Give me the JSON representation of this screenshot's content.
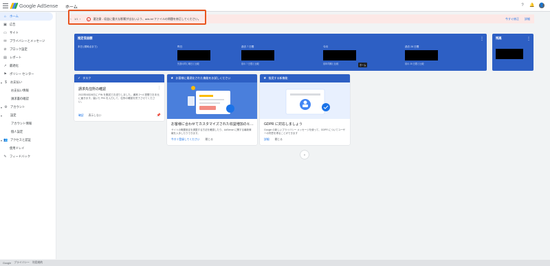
{
  "app": {
    "brand": "Google AdSense",
    "page_title": "ホーム"
  },
  "header": {
    "help_icon": "?",
    "bell_icon": "🔔",
    "avatar_icon": "👤"
  },
  "sidebar": {
    "items": [
      {
        "icon": "⌂",
        "label": "ホーム",
        "active": true,
        "kind": "top"
      },
      {
        "icon": "▣",
        "label": "広告",
        "kind": "top"
      },
      {
        "icon": "▭",
        "label": "サイト",
        "kind": "top"
      },
      {
        "icon": "✉",
        "label": "プライバシーとメッセージ",
        "kind": "top"
      },
      {
        "icon": "⊘",
        "label": "ブロック設定",
        "kind": "top"
      },
      {
        "icon": "▤",
        "label": "レポート",
        "kind": "top"
      },
      {
        "icon": "↗",
        "label": "最適化",
        "kind": "top"
      },
      {
        "icon": "⚑",
        "label": "ポリシー センター",
        "kind": "top"
      },
      {
        "icon": "$",
        "label": "お支払い",
        "kind": "exp"
      },
      {
        "icon": "",
        "label": "お支払い情報",
        "kind": "sub"
      },
      {
        "icon": "",
        "label": "請求書の確認",
        "kind": "sub"
      },
      {
        "icon": "⚙",
        "label": "アカウント",
        "kind": "exp"
      },
      {
        "icon": "",
        "label": "設定",
        "kind": "exp"
      },
      {
        "icon": "",
        "label": "アカウント情報",
        "kind": "sub"
      },
      {
        "icon": "",
        "label": "個人設定",
        "kind": "sub"
      },
      {
        "icon": "👥",
        "label": "アクセスと認証",
        "kind": "exp"
      },
      {
        "icon": "",
        "label": "使用ドレイ",
        "kind": "top"
      },
      {
        "icon": "✎",
        "label": "フィードバック",
        "kind": "top"
      }
    ]
  },
  "alert": {
    "prev": "‹",
    "counter": "1/1",
    "next": "›",
    "warn_icon": "!",
    "message": "要注意 - 収益に重大な影響が出ないよう、ads.txt ファイルの問題を修正してください。",
    "action_fix": "今すぐ修正",
    "action_details": "詳細"
  },
  "earnings": {
    "title": "推定収益額",
    "menu": "⋮",
    "columns": [
      {
        "label": "本日 (現時点まで)",
        "sub": ""
      },
      {
        "label": "昨日",
        "sub": "先週の同じ曜日と比較"
      },
      {
        "label": "過去 7 日間",
        "sub": "前の 7 日間と比較"
      },
      {
        "label": "今月",
        "sub": "前年同期と比較"
      },
      {
        "label": "過去 28 日間",
        "sub": "前の 28 日間と比較"
      }
    ],
    "tooltip": "ホーム"
  },
  "balance": {
    "title": "残高",
    "menu": "⋮"
  },
  "task_card": {
    "header": "タスク",
    "header_icon": "✓",
    "title": "請求先住所の確認",
    "menu": "⋮",
    "body": "2022年8月28日に PIN を郵送でお送りしました。通常 2～4 週間でお手元に届きます。届いた PIN を入力して、住所の確認を完了させてください。",
    "link_primary": "確認",
    "link_secondary": "表示しない",
    "pin_icon": "📌"
  },
  "promo1": {
    "header": "お客様に最適化された機能をお試しください",
    "header_icon": "★",
    "heading": "お客様に合わせてカスタマイズされた収益増加のヒ…",
    "desc": "サイトの概要設定を調整する方法を確認したり、AdSense に関する最新情報を入手したりできます。",
    "link_primary": "今すぐ登録してください",
    "link_secondary": "閉じる"
  },
  "promo2": {
    "header": "推奨する新機能",
    "header_icon": "★",
    "heading": "GDPR に対応しましょう",
    "desc": "Google の新しいプライバシー メッセージを使って、GDPR についてユーザーの同意を得ることができます",
    "link_primary": "詳細",
    "link_secondary": "閉じる"
  },
  "more_button": "⌄",
  "footer": {
    "items": [
      "Google",
      "プライバシー",
      "利用規約"
    ]
  },
  "colors": {
    "accent": "#1a73e8",
    "card_blue": "#2d5fc4",
    "alert_bg": "#fce8e6",
    "highlight": "#e8541e"
  }
}
